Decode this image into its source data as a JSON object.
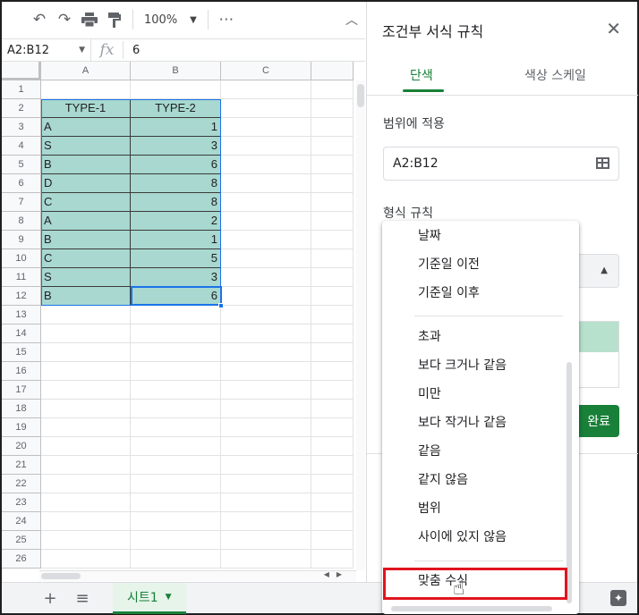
{
  "toolbar": {
    "zoom": "100%",
    "more": "⋯"
  },
  "formula_bar": {
    "name_box": "A2:B12",
    "fx": "fx",
    "value": "6"
  },
  "grid": {
    "columns": [
      "A",
      "B",
      "C"
    ],
    "rows": [
      "1",
      "2",
      "3",
      "4",
      "5",
      "6",
      "7",
      "8",
      "9",
      "10",
      "11",
      "12",
      "13",
      "14",
      "15",
      "16",
      "17",
      "18",
      "19",
      "20",
      "21",
      "22",
      "23",
      "24",
      "25",
      "26"
    ],
    "table": [
      [
        "TYPE-1",
        "TYPE-2"
      ],
      [
        "A",
        "1"
      ],
      [
        "S",
        "3"
      ],
      [
        "B",
        "6"
      ],
      [
        "D",
        "8"
      ],
      [
        "C",
        "8"
      ],
      [
        "A",
        "2"
      ],
      [
        "B",
        "1"
      ],
      [
        "C",
        "5"
      ],
      [
        "S",
        "3"
      ],
      [
        "B",
        "6"
      ]
    ]
  },
  "bottom_bar": {
    "sheet_tab": "시트1"
  },
  "panel": {
    "title": "조건부 서식 규칙",
    "tabs": [
      "단색",
      "색상 스케일"
    ],
    "apply_range_label": "범위에 적용",
    "range_value": "A2:B12",
    "format_rules_label": "형식 규칙",
    "done_button": "완료"
  },
  "dropdown": {
    "items_group1": [
      "날짜",
      "기준일 이전",
      "기준일 이후"
    ],
    "items_group2": [
      "초과",
      "보다 크거나 같음",
      "미만",
      "보다 작거나 같음",
      "같음",
      "같지 않음",
      "범위",
      "사이에 있지 않음"
    ],
    "items_group3": [
      "맞춤 수식"
    ]
  },
  "colors": {
    "accent": "#188038",
    "fill": "#a8d8cf",
    "highlight": "#e0141e",
    "selection": "#1a73e8"
  }
}
